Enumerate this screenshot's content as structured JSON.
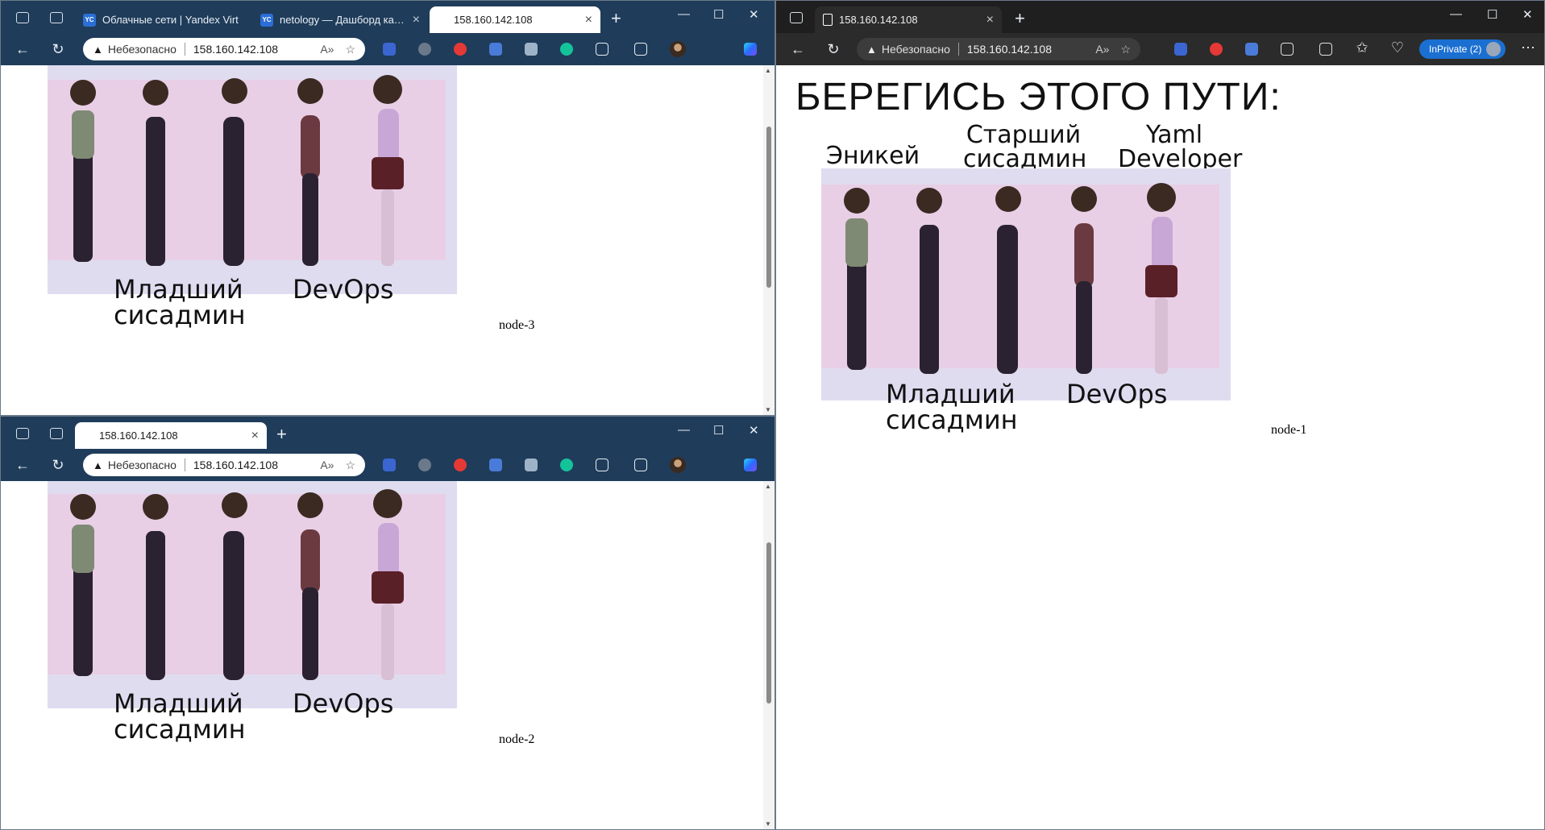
{
  "colors": {
    "blue_frame": "#1f3c5a",
    "dark_frame": "#1f1f1f",
    "meme_bg": "#e0dcf0",
    "meme_band": "#e8cfe6",
    "inprivate": "#1b6fd1"
  },
  "meme_captions": {
    "anykey": "Эникей",
    "senior_line1": "Старший",
    "senior_line2": "сисадмин",
    "yaml_line1": "Yaml",
    "yaml_line2": "Developer",
    "junior_line1": "Младший",
    "junior_line2": "сисадмин",
    "devops": "DevOps"
  },
  "windows": {
    "node3": {
      "tabs": [
        {
          "favicon": "YC",
          "label": "Облачные сети | Yandex Virt"
        },
        {
          "favicon": "YC",
          "label": "netology — Дашборд катал"
        },
        {
          "favicon": "page-icon",
          "label": "158.160.142.108"
        }
      ],
      "address": {
        "security": "Небезопасно",
        "url": "158.160.142.108"
      },
      "node_label": "node-3"
    },
    "node2": {
      "tabs": [
        {
          "favicon": "page-icon",
          "label": "158.160.142.108"
        }
      ],
      "address": {
        "security": "Небезопасно",
        "url": "158.160.142.108"
      },
      "node_label": "node-2"
    },
    "node1": {
      "tabs": [
        {
          "favicon": "page-icon",
          "label": "158.160.142.108"
        }
      ],
      "address": {
        "security": "Небезопасно",
        "url": "158.160.142.108"
      },
      "inprivate": "InPrivate (2)",
      "heading": "БЕРЕГИСЬ ЭТОГО ПУТИ:",
      "node_label": "node-1"
    }
  }
}
